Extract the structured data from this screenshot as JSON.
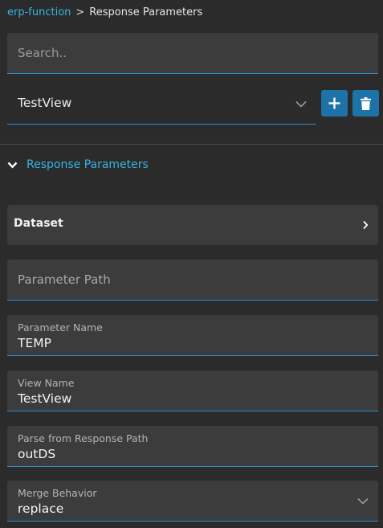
{
  "breadcrumb": {
    "parent": "erp-function",
    "separator": ">",
    "current": "Response Parameters"
  },
  "search": {
    "placeholder": "Search.."
  },
  "view_selector": {
    "value": "TestView"
  },
  "actions": {
    "add_icon": "plus-icon",
    "delete_icon": "trash-icon"
  },
  "section": {
    "title": "Response Parameters",
    "expanded": true
  },
  "dataset": {
    "label": "Dataset"
  },
  "form": {
    "parameter_path": {
      "placeholder": "Parameter Path",
      "value": ""
    },
    "parameter_name": {
      "label": "Parameter Name",
      "value": "TEMP"
    },
    "view_name": {
      "label": "View Name",
      "value": "TestView"
    },
    "parse_path": {
      "label": "Parse from Response Path",
      "value": "outDS"
    },
    "merge_behavior": {
      "label": "Merge Behavior",
      "value": "replace"
    }
  },
  "colors": {
    "accent": "#35b5e5",
    "button": "#1d72a8",
    "field_bg": "#3c3c3c",
    "background": "#2b2b2b",
    "underline": "#2d8fd0"
  }
}
